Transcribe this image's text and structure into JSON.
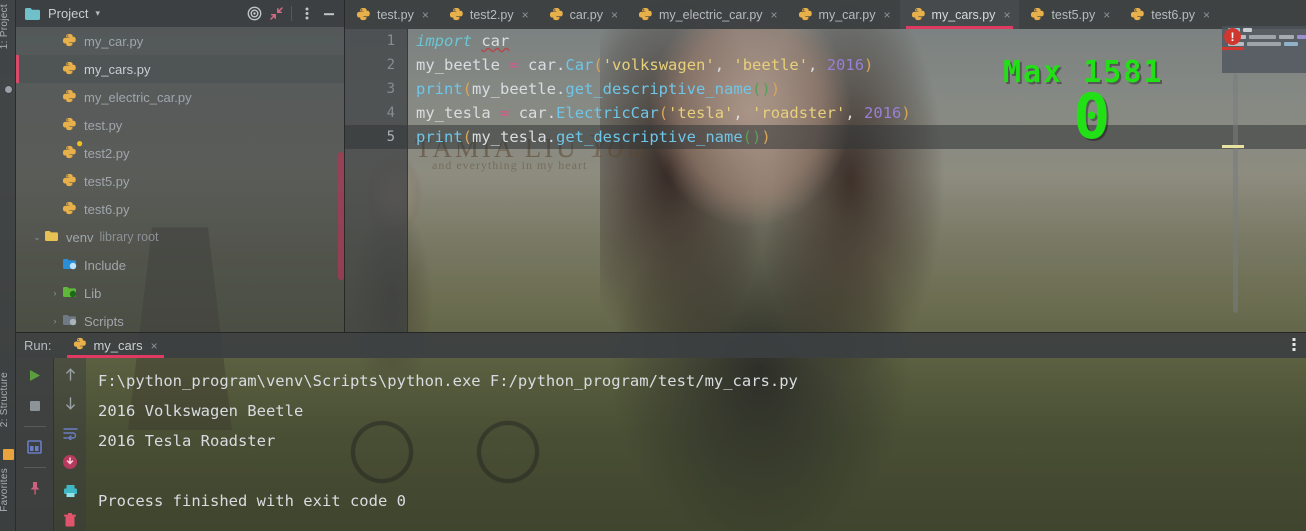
{
  "app": {
    "left_strip": {
      "project_tab": "1: Project",
      "structure_tab": "2: Structure",
      "favorites_tab": "Favorites"
    }
  },
  "project_panel": {
    "title": "Project",
    "chevron": "▾",
    "icons": {
      "folder": "folder-icon",
      "target": "scroll-from-source-icon",
      "collapse": "collapse-all-icon",
      "options": "options-menu-icon",
      "hide": "hide-panel-icon"
    },
    "tree": [
      {
        "label": "my_car.py",
        "icon": "python-file-icon",
        "indent": 2,
        "arrow": "",
        "selected": false
      },
      {
        "label": "my_cars.py",
        "icon": "python-file-icon",
        "indent": 2,
        "arrow": "",
        "selected": true
      },
      {
        "label": "my_electric_car.py",
        "icon": "python-file-icon",
        "indent": 2,
        "arrow": "",
        "selected": false
      },
      {
        "label": "test.py",
        "icon": "python-file-icon",
        "indent": 2,
        "arrow": "",
        "selected": false
      },
      {
        "label": "test2.py",
        "icon": "python-file-icon",
        "indent": 2,
        "arrow": "",
        "selected": false
      },
      {
        "label": "test5.py",
        "icon": "python-file-icon",
        "indent": 2,
        "arrow": "",
        "selected": false
      },
      {
        "label": "test6.py",
        "icon": "python-file-icon",
        "indent": 2,
        "arrow": "",
        "selected": false
      },
      {
        "label": "venv",
        "icon": "venv-folder-icon",
        "indent": 1,
        "arrow": "⌄",
        "selected": false,
        "suffix": "library root"
      },
      {
        "label": "Include",
        "icon": "include-folder-icon",
        "indent": 2,
        "arrow": "",
        "selected": false
      },
      {
        "label": "Lib",
        "icon": "lib-folder-icon",
        "indent": 2,
        "arrow": "›",
        "selected": false
      },
      {
        "label": "Scripts",
        "icon": "scripts-folder-icon",
        "indent": 2,
        "arrow": "›",
        "selected": false
      }
    ]
  },
  "editor_tabs": [
    {
      "label": "test.py",
      "active": false
    },
    {
      "label": "test2.py",
      "active": false
    },
    {
      "label": "car.py",
      "active": false
    },
    {
      "label": "my_electric_car.py",
      "active": false
    },
    {
      "label": "my_car.py",
      "active": false
    },
    {
      "label": "my_cars.py",
      "active": true
    },
    {
      "label": "test5.py",
      "active": false
    },
    {
      "label": "test6.py",
      "active": false
    }
  ],
  "editor": {
    "close_glyph": "×",
    "line_numbers": [
      "1",
      "2",
      "3",
      "4",
      "5"
    ],
    "current_line": 5,
    "error_badge": "!",
    "lines": [
      {
        "n": 1,
        "tokens": [
          {
            "t": "import",
            "c": "kw-import"
          },
          {
            "t": " ",
            "c": "punct"
          },
          {
            "t": "car",
            "c": "err-underline"
          }
        ]
      },
      {
        "n": 2,
        "tokens": [
          {
            "t": "my_beetle",
            "c": "ident"
          },
          {
            "t": " ",
            "c": "punct"
          },
          {
            "t": "=",
            "c": "op"
          },
          {
            "t": " ",
            "c": "punct"
          },
          {
            "t": "car",
            "c": "ident"
          },
          {
            "t": ".",
            "c": "punct"
          },
          {
            "t": "Car",
            "c": "cls"
          },
          {
            "t": "(",
            "c": "paren"
          },
          {
            "t": "'volkswagen'",
            "c": "str"
          },
          {
            "t": ", ",
            "c": "punct"
          },
          {
            "t": "'beetle'",
            "c": "str"
          },
          {
            "t": ", ",
            "c": "punct"
          },
          {
            "t": "2016",
            "c": "num"
          },
          {
            "t": ")",
            "c": "paren"
          }
        ]
      },
      {
        "n": 3,
        "tokens": [
          {
            "t": "print",
            "c": "fn"
          },
          {
            "t": "(",
            "c": "paren"
          },
          {
            "t": "my_beetle",
            "c": "ident"
          },
          {
            "t": ".",
            "c": "punct"
          },
          {
            "t": "get_descriptive_name",
            "c": "fn"
          },
          {
            "t": "(",
            "c": "paren2"
          },
          {
            "t": ")",
            "c": "paren2"
          },
          {
            "t": ")",
            "c": "paren"
          }
        ]
      },
      {
        "n": 4,
        "tokens": [
          {
            "t": "my_tesla",
            "c": "ident"
          },
          {
            "t": " ",
            "c": "punct"
          },
          {
            "t": "=",
            "c": "op"
          },
          {
            "t": " ",
            "c": "punct"
          },
          {
            "t": "car",
            "c": "ident"
          },
          {
            "t": ".",
            "c": "punct"
          },
          {
            "t": "ElectricCar",
            "c": "cls"
          },
          {
            "t": "(",
            "c": "paren"
          },
          {
            "t": "'tesla'",
            "c": "str"
          },
          {
            "t": ", ",
            "c": "punct"
          },
          {
            "t": "'roadster'",
            "c": "str"
          },
          {
            "t": ", ",
            "c": "punct"
          },
          {
            "t": "2016",
            "c": "num"
          },
          {
            "t": ")",
            "c": "paren"
          }
        ]
      },
      {
        "n": 5,
        "tokens": [
          {
            "t": "print",
            "c": "fn"
          },
          {
            "t": "(",
            "c": "paren"
          },
          {
            "t": "my_tesla",
            "c": "ident"
          },
          {
            "t": ".",
            "c": "punct"
          },
          {
            "t": "get_descriptive_name",
            "c": "fn"
          },
          {
            "t": "(",
            "c": "paren2"
          },
          {
            "t": ")",
            "c": "paren2"
          },
          {
            "t": ")",
            "c": "paren"
          }
        ]
      }
    ]
  },
  "overlays": {
    "pixel_watermark": "Max  1581",
    "pixel_watermark_zero": "0",
    "photo_watermark_1": "TAMIA LIU",
    "photo_watermark_2": "You",
    "photo_watermark_sub": "and everything in my heart"
  },
  "run_panel": {
    "label": "Run:",
    "tab_name": "my_cars",
    "tab_icon": "python-file-icon",
    "close_glyph": "×",
    "more_glyph": "⋮",
    "toolbar_left": [
      {
        "name": "rerun-button",
        "glyph": "▶",
        "color": "#5a9e3f"
      },
      {
        "name": "stop-button",
        "glyph": "■",
        "color": "#8d9499"
      },
      {
        "name": "layout-button",
        "glyph": "▦",
        "color": "#6a7ec4"
      },
      {
        "name": "pin-tab-button",
        "glyph": "⚑",
        "color": "#d06080"
      }
    ],
    "toolbar_right": [
      {
        "name": "up-stack-button",
        "glyph": "↑",
        "color": "#9aa1a7"
      },
      {
        "name": "down-stack-button",
        "glyph": "↓",
        "color": "#9aa1a7"
      },
      {
        "name": "soft-wrap-button",
        "glyph": "↵",
        "color": "#6a7ec4"
      },
      {
        "name": "scroll-to-end-button",
        "glyph": "⬇",
        "color": "#d0486e"
      },
      {
        "name": "print-button",
        "glyph": "⎙",
        "color": "#3fb8c4"
      },
      {
        "name": "clear-all-button",
        "glyph": "Ὕ1",
        "color": "#e0556c"
      }
    ],
    "console_lines": [
      "F:\\python_program\\venv\\Scripts\\python.exe F:/python_program/test/my_cars.py",
      "2016 Volkswagen Beetle",
      "2016 Tesla Roadster",
      "",
      "Process finished with exit code 0"
    ]
  },
  "colors": {
    "accent": "#e03a63",
    "error": "#d0372f",
    "panel": "#3c3f41",
    "green": "#22e016"
  }
}
